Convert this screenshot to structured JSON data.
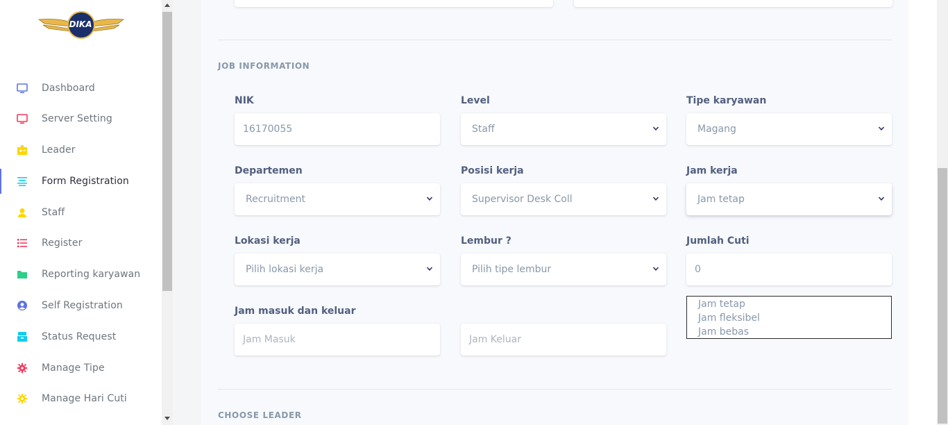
{
  "brand": {
    "logo_text": "DIKA"
  },
  "sidebar": {
    "items": [
      {
        "label": "Dashboard",
        "icon": "monitor-icon",
        "color": "#5e72e4"
      },
      {
        "label": "Server Setting",
        "icon": "monitor-red-icon",
        "color": "#f5365c"
      },
      {
        "label": "Leader",
        "icon": "badge-icon",
        "color": "#ffd600"
      },
      {
        "label": "Form Registration",
        "icon": "align-left-icon",
        "color": "#11cdef"
      },
      {
        "label": "Staff",
        "icon": "user-icon",
        "color": "#ffd600"
      },
      {
        "label": "Register",
        "icon": "list-icon",
        "color": "#f5365c"
      },
      {
        "label": "Reporting karyawan",
        "icon": "folder-icon",
        "color": "#2dce89"
      },
      {
        "label": "Self Registration",
        "icon": "user-circle-icon",
        "color": "#5e72e4"
      },
      {
        "label": "Status Request",
        "icon": "archive-icon",
        "color": "#11cdef"
      },
      {
        "label": "Manage Tipe",
        "icon": "gear-icon",
        "color": "#f5365c"
      },
      {
        "label": "Manage Hari Cuti",
        "icon": "gear-yellow-icon",
        "color": "#ffd600"
      }
    ]
  },
  "job_information": {
    "title": "JOB INFORMATION",
    "nik": {
      "label": "NIK",
      "value": "16170055"
    },
    "level": {
      "label": "Level",
      "value": "Staff"
    },
    "tipe_karyawan": {
      "label": "Tipe karyawan",
      "value": "Magang"
    },
    "departemen": {
      "label": "Departemen",
      "value": "Recruitment"
    },
    "posisi_kerja": {
      "label": "Posisi kerja",
      "value": "Supervisor Desk Coll"
    },
    "jam_kerja": {
      "label": "Jam kerja",
      "value": "Jam tetap",
      "options": [
        "Jam tetap",
        "Jam fleksibel",
        "Jam bebas"
      ]
    },
    "lokasi_kerja": {
      "label": "Lokasi kerja",
      "value": "Pilih lokasi kerja"
    },
    "lembur": {
      "label": "Lembur ?",
      "value": "Pilih tipe lembur"
    },
    "jumlah_cuti": {
      "label": "Jumlah Cuti",
      "value": "0"
    },
    "jam_masuk_keluar": {
      "label": "Jam masuk dan keluar",
      "masuk_placeholder": "Jam Masuk",
      "keluar_placeholder": "Jam Keluar"
    }
  },
  "choose_leader": {
    "title": "CHOOSE LEADER"
  }
}
